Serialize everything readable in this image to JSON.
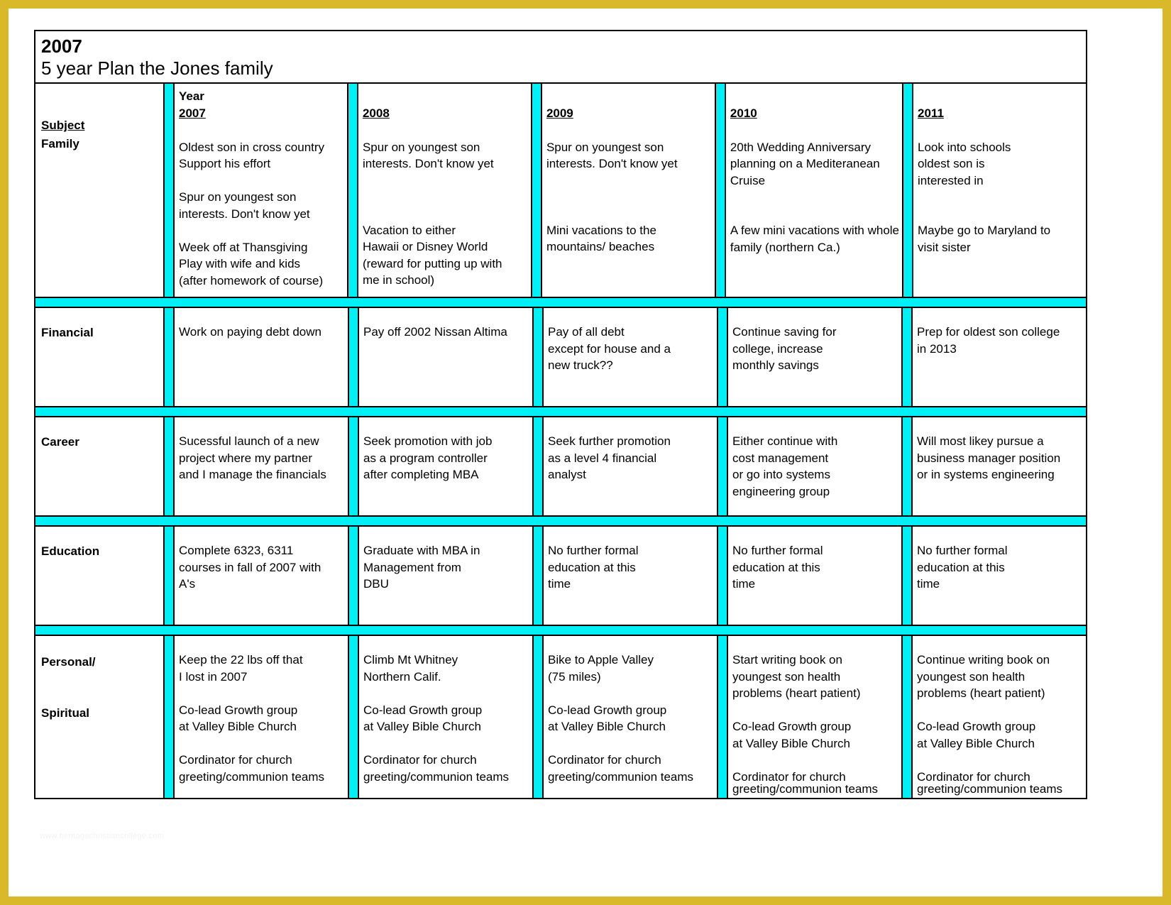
{
  "page": {
    "title_year": "2007",
    "title_subtitle": "5 year Plan the Jones family",
    "frame_color": "#d9b829",
    "separator_color": "#00f0f5",
    "watermark": "www.heritagechristiancollege.com"
  },
  "header": {
    "year_label": "Year",
    "subject_label": "Subject",
    "years": [
      "2007",
      "2008",
      "2009",
      "2010",
      "2011"
    ]
  },
  "rows": [
    {
      "subject": "Family",
      "subject_extra": "",
      "cells": [
        {
          "blocks": [
            "Oldest son in cross country\nSupport his effort",
            "Spur on youngest son\ninterests. Don't know yet",
            "Week off at Thansgiving\nPlay with wife and kids\n(after homework of course)"
          ]
        },
        {
          "blocks": [
            "Spur on youngest son\ninterests. Don't know yet",
            "",
            "Vacation to either\nHawaii or Disney World\n(reward for putting up with\nme in school)"
          ]
        },
        {
          "blocks": [
            "Spur on youngest son\ninterests. Don't know yet",
            "",
            "Mini vacations to the\nmountains/ beaches"
          ]
        },
        {
          "blocks": [
            "20th Wedding Anniversary\nplanning on a Mediteranean\nCruise",
            "",
            "A few mini vacations with whole\nfamily (northern Ca.)"
          ]
        },
        {
          "blocks": [
            "Look into schools\noldest son is\ninterested in",
            "",
            "Maybe go to Maryland to\nvisit sister"
          ]
        }
      ]
    },
    {
      "subject": "Financial",
      "subject_extra": "",
      "cells": [
        {
          "blocks": [
            "Work on paying debt down"
          ]
        },
        {
          "blocks": [
            "Pay off 2002 Nissan Altima"
          ]
        },
        {
          "blocks": [
            "Pay of all debt\nexcept for house and a\nnew truck??"
          ]
        },
        {
          "blocks": [
            "Continue saving for\ncollege, increase\nmonthly savings"
          ]
        },
        {
          "blocks": [
            "Prep for oldest son college\nin 2013"
          ]
        }
      ]
    },
    {
      "subject": "Career",
      "subject_extra": "",
      "cells": [
        {
          "blocks": [
            "Sucessful launch of a new\nproject where my partner\nand I manage the financials"
          ]
        },
        {
          "blocks": [
            "Seek promotion with job\nas a program controller\nafter completing MBA"
          ]
        },
        {
          "blocks": [
            "Seek further promotion\nas a level 4 financial\nanalyst"
          ]
        },
        {
          "blocks": [
            "Either continue with\ncost management\nor go into systems\nengineering group"
          ]
        },
        {
          "blocks": [
            "Will most likey pursue a\nbusiness manager position\nor in systems engineering"
          ]
        }
      ]
    },
    {
      "subject": "Education",
      "subject_extra": "",
      "cells": [
        {
          "blocks": [
            "Complete 6323, 6311\ncourses in fall of 2007 with\nA's"
          ]
        },
        {
          "blocks": [
            "Graduate with MBA in\nManagement from\nDBU"
          ]
        },
        {
          "blocks": [
            "No further formal\neducation at this\ntime"
          ]
        },
        {
          "blocks": [
            "No further formal\neducation at this\ntime"
          ]
        },
        {
          "blocks": [
            "No further formal\neducation at this\ntime"
          ]
        }
      ]
    },
    {
      "subject": "Personal/",
      "subject_extra": "Spiritual",
      "cells": [
        {
          "blocks": [
            "Keep the 22 lbs off that\nI lost in 2007",
            "Co-lead Growth group\nat Valley Bible Church",
            "Cordinator for church\ngreeting/communion teams"
          ]
        },
        {
          "blocks": [
            "Climb Mt Whitney\nNorthern Calif.",
            "Co-lead Growth group\nat Valley Bible Church",
            "Cordinator for church\ngreeting/communion teams"
          ]
        },
        {
          "blocks": [
            "Bike to Apple Valley\n(75 miles)",
            "Co-lead Growth group\nat Valley Bible Church",
            "Cordinator for church\ngreeting/communion teams"
          ]
        },
        {
          "blocks": [
            "Start writing book on\nyoungest son health\nproblems (heart patient)",
            "Co-lead Growth group\nat Valley Bible Church",
            "Cordinator for church"
          ],
          "tail": "greeting/communion teams"
        },
        {
          "blocks": [
            "Continue writing book on\nyoungest son health\nproblems (heart patient)",
            "Co-lead Growth group\nat Valley Bible Church",
            "Cordinator for church"
          ],
          "tail": "greeting/communion teams"
        }
      ]
    }
  ]
}
